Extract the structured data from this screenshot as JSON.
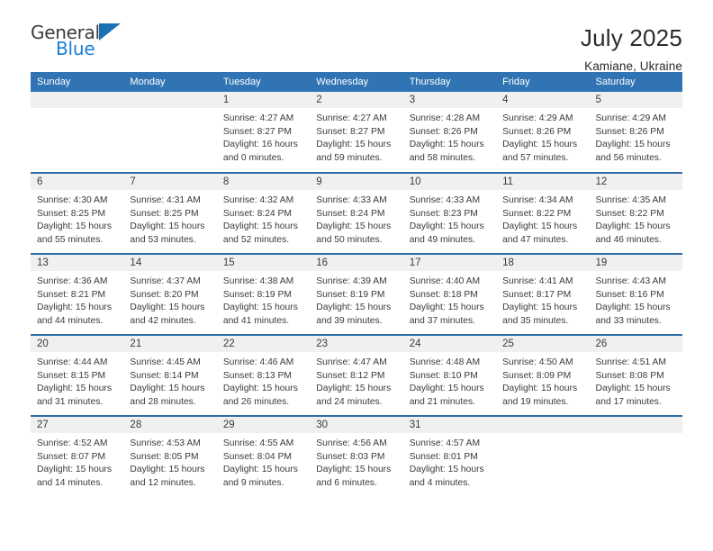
{
  "logo": {
    "word1": "General",
    "word2": "Blue",
    "triangle_color": "#1b6fb3",
    "blue_text_color": "#1b7fd4"
  },
  "header": {
    "title": "July 2025",
    "subtitle": "Kamiane, Ukraine"
  },
  "theme": {
    "header_blue": "#3174b4",
    "row_divider_blue": "#2e6da4",
    "daynum_band": "#f0f0f0"
  },
  "weekdays": [
    "Sunday",
    "Monday",
    "Tuesday",
    "Wednesday",
    "Thursday",
    "Friday",
    "Saturday"
  ],
  "weeks": [
    [
      {
        "day": "",
        "lines": []
      },
      {
        "day": "",
        "lines": []
      },
      {
        "day": "1",
        "lines": [
          "Sunrise: 4:27 AM",
          "Sunset: 8:27 PM",
          "Daylight: 16 hours",
          "and 0 minutes."
        ]
      },
      {
        "day": "2",
        "lines": [
          "Sunrise: 4:27 AM",
          "Sunset: 8:27 PM",
          "Daylight: 15 hours",
          "and 59 minutes."
        ]
      },
      {
        "day": "3",
        "lines": [
          "Sunrise: 4:28 AM",
          "Sunset: 8:26 PM",
          "Daylight: 15 hours",
          "and 58 minutes."
        ]
      },
      {
        "day": "4",
        "lines": [
          "Sunrise: 4:29 AM",
          "Sunset: 8:26 PM",
          "Daylight: 15 hours",
          "and 57 minutes."
        ]
      },
      {
        "day": "5",
        "lines": [
          "Sunrise: 4:29 AM",
          "Sunset: 8:26 PM",
          "Daylight: 15 hours",
          "and 56 minutes."
        ]
      }
    ],
    [
      {
        "day": "6",
        "lines": [
          "Sunrise: 4:30 AM",
          "Sunset: 8:25 PM",
          "Daylight: 15 hours",
          "and 55 minutes."
        ]
      },
      {
        "day": "7",
        "lines": [
          "Sunrise: 4:31 AM",
          "Sunset: 8:25 PM",
          "Daylight: 15 hours",
          "and 53 minutes."
        ]
      },
      {
        "day": "8",
        "lines": [
          "Sunrise: 4:32 AM",
          "Sunset: 8:24 PM",
          "Daylight: 15 hours",
          "and 52 minutes."
        ]
      },
      {
        "day": "9",
        "lines": [
          "Sunrise: 4:33 AM",
          "Sunset: 8:24 PM",
          "Daylight: 15 hours",
          "and 50 minutes."
        ]
      },
      {
        "day": "10",
        "lines": [
          "Sunrise: 4:33 AM",
          "Sunset: 8:23 PM",
          "Daylight: 15 hours",
          "and 49 minutes."
        ]
      },
      {
        "day": "11",
        "lines": [
          "Sunrise: 4:34 AM",
          "Sunset: 8:22 PM",
          "Daylight: 15 hours",
          "and 47 minutes."
        ]
      },
      {
        "day": "12",
        "lines": [
          "Sunrise: 4:35 AM",
          "Sunset: 8:22 PM",
          "Daylight: 15 hours",
          "and 46 minutes."
        ]
      }
    ],
    [
      {
        "day": "13",
        "lines": [
          "Sunrise: 4:36 AM",
          "Sunset: 8:21 PM",
          "Daylight: 15 hours",
          "and 44 minutes."
        ]
      },
      {
        "day": "14",
        "lines": [
          "Sunrise: 4:37 AM",
          "Sunset: 8:20 PM",
          "Daylight: 15 hours",
          "and 42 minutes."
        ]
      },
      {
        "day": "15",
        "lines": [
          "Sunrise: 4:38 AM",
          "Sunset: 8:19 PM",
          "Daylight: 15 hours",
          "and 41 minutes."
        ]
      },
      {
        "day": "16",
        "lines": [
          "Sunrise: 4:39 AM",
          "Sunset: 8:19 PM",
          "Daylight: 15 hours",
          "and 39 minutes."
        ]
      },
      {
        "day": "17",
        "lines": [
          "Sunrise: 4:40 AM",
          "Sunset: 8:18 PM",
          "Daylight: 15 hours",
          "and 37 minutes."
        ]
      },
      {
        "day": "18",
        "lines": [
          "Sunrise: 4:41 AM",
          "Sunset: 8:17 PM",
          "Daylight: 15 hours",
          "and 35 minutes."
        ]
      },
      {
        "day": "19",
        "lines": [
          "Sunrise: 4:43 AM",
          "Sunset: 8:16 PM",
          "Daylight: 15 hours",
          "and 33 minutes."
        ]
      }
    ],
    [
      {
        "day": "20",
        "lines": [
          "Sunrise: 4:44 AM",
          "Sunset: 8:15 PM",
          "Daylight: 15 hours",
          "and 31 minutes."
        ]
      },
      {
        "day": "21",
        "lines": [
          "Sunrise: 4:45 AM",
          "Sunset: 8:14 PM",
          "Daylight: 15 hours",
          "and 28 minutes."
        ]
      },
      {
        "day": "22",
        "lines": [
          "Sunrise: 4:46 AM",
          "Sunset: 8:13 PM",
          "Daylight: 15 hours",
          "and 26 minutes."
        ]
      },
      {
        "day": "23",
        "lines": [
          "Sunrise: 4:47 AM",
          "Sunset: 8:12 PM",
          "Daylight: 15 hours",
          "and 24 minutes."
        ]
      },
      {
        "day": "24",
        "lines": [
          "Sunrise: 4:48 AM",
          "Sunset: 8:10 PM",
          "Daylight: 15 hours",
          "and 21 minutes."
        ]
      },
      {
        "day": "25",
        "lines": [
          "Sunrise: 4:50 AM",
          "Sunset: 8:09 PM",
          "Daylight: 15 hours",
          "and 19 minutes."
        ]
      },
      {
        "day": "26",
        "lines": [
          "Sunrise: 4:51 AM",
          "Sunset: 8:08 PM",
          "Daylight: 15 hours",
          "and 17 minutes."
        ]
      }
    ],
    [
      {
        "day": "27",
        "lines": [
          "Sunrise: 4:52 AM",
          "Sunset: 8:07 PM",
          "Daylight: 15 hours",
          "and 14 minutes."
        ]
      },
      {
        "day": "28",
        "lines": [
          "Sunrise: 4:53 AM",
          "Sunset: 8:05 PM",
          "Daylight: 15 hours",
          "and 12 minutes."
        ]
      },
      {
        "day": "29",
        "lines": [
          "Sunrise: 4:55 AM",
          "Sunset: 8:04 PM",
          "Daylight: 15 hours",
          "and 9 minutes."
        ]
      },
      {
        "day": "30",
        "lines": [
          "Sunrise: 4:56 AM",
          "Sunset: 8:03 PM",
          "Daylight: 15 hours",
          "and 6 minutes."
        ]
      },
      {
        "day": "31",
        "lines": [
          "Sunrise: 4:57 AM",
          "Sunset: 8:01 PM",
          "Daylight: 15 hours",
          "and 4 minutes."
        ]
      },
      {
        "day": "",
        "lines": []
      },
      {
        "day": "",
        "lines": []
      }
    ]
  ]
}
